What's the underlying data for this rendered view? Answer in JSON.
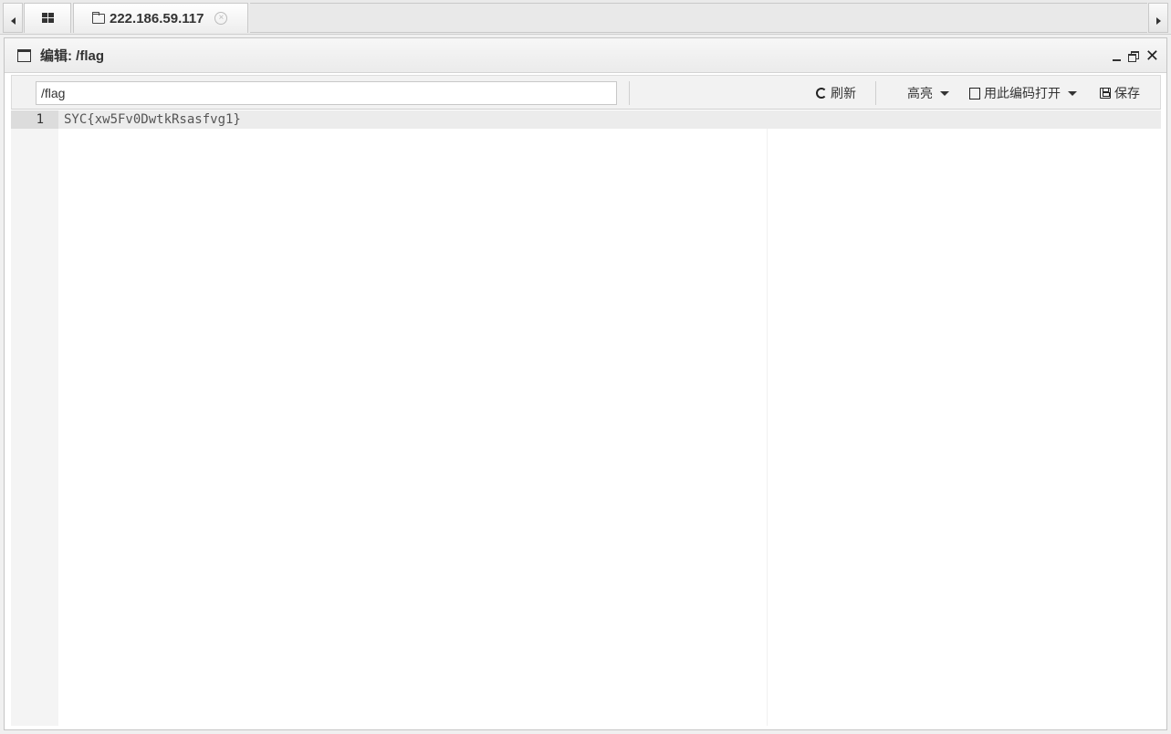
{
  "tabs": {
    "home_icon": "grid-icon",
    "host_tab": {
      "icon": "folder-icon",
      "label": "222.186.59.117",
      "close_glyph": "×"
    }
  },
  "window": {
    "icon": "window-icon",
    "title": "编辑: /flag",
    "close_glyph": "✕"
  },
  "toolbar": {
    "path_value": "/flag",
    "refresh_label": "刷新",
    "highlight_label": "高亮",
    "open_with_encoding_label": "用此编码打开",
    "save_label": "保存"
  },
  "editor": {
    "lines": [
      {
        "number": "1",
        "text": "SYC{xw5Fv0DwtkRsasfvg1}"
      }
    ]
  }
}
